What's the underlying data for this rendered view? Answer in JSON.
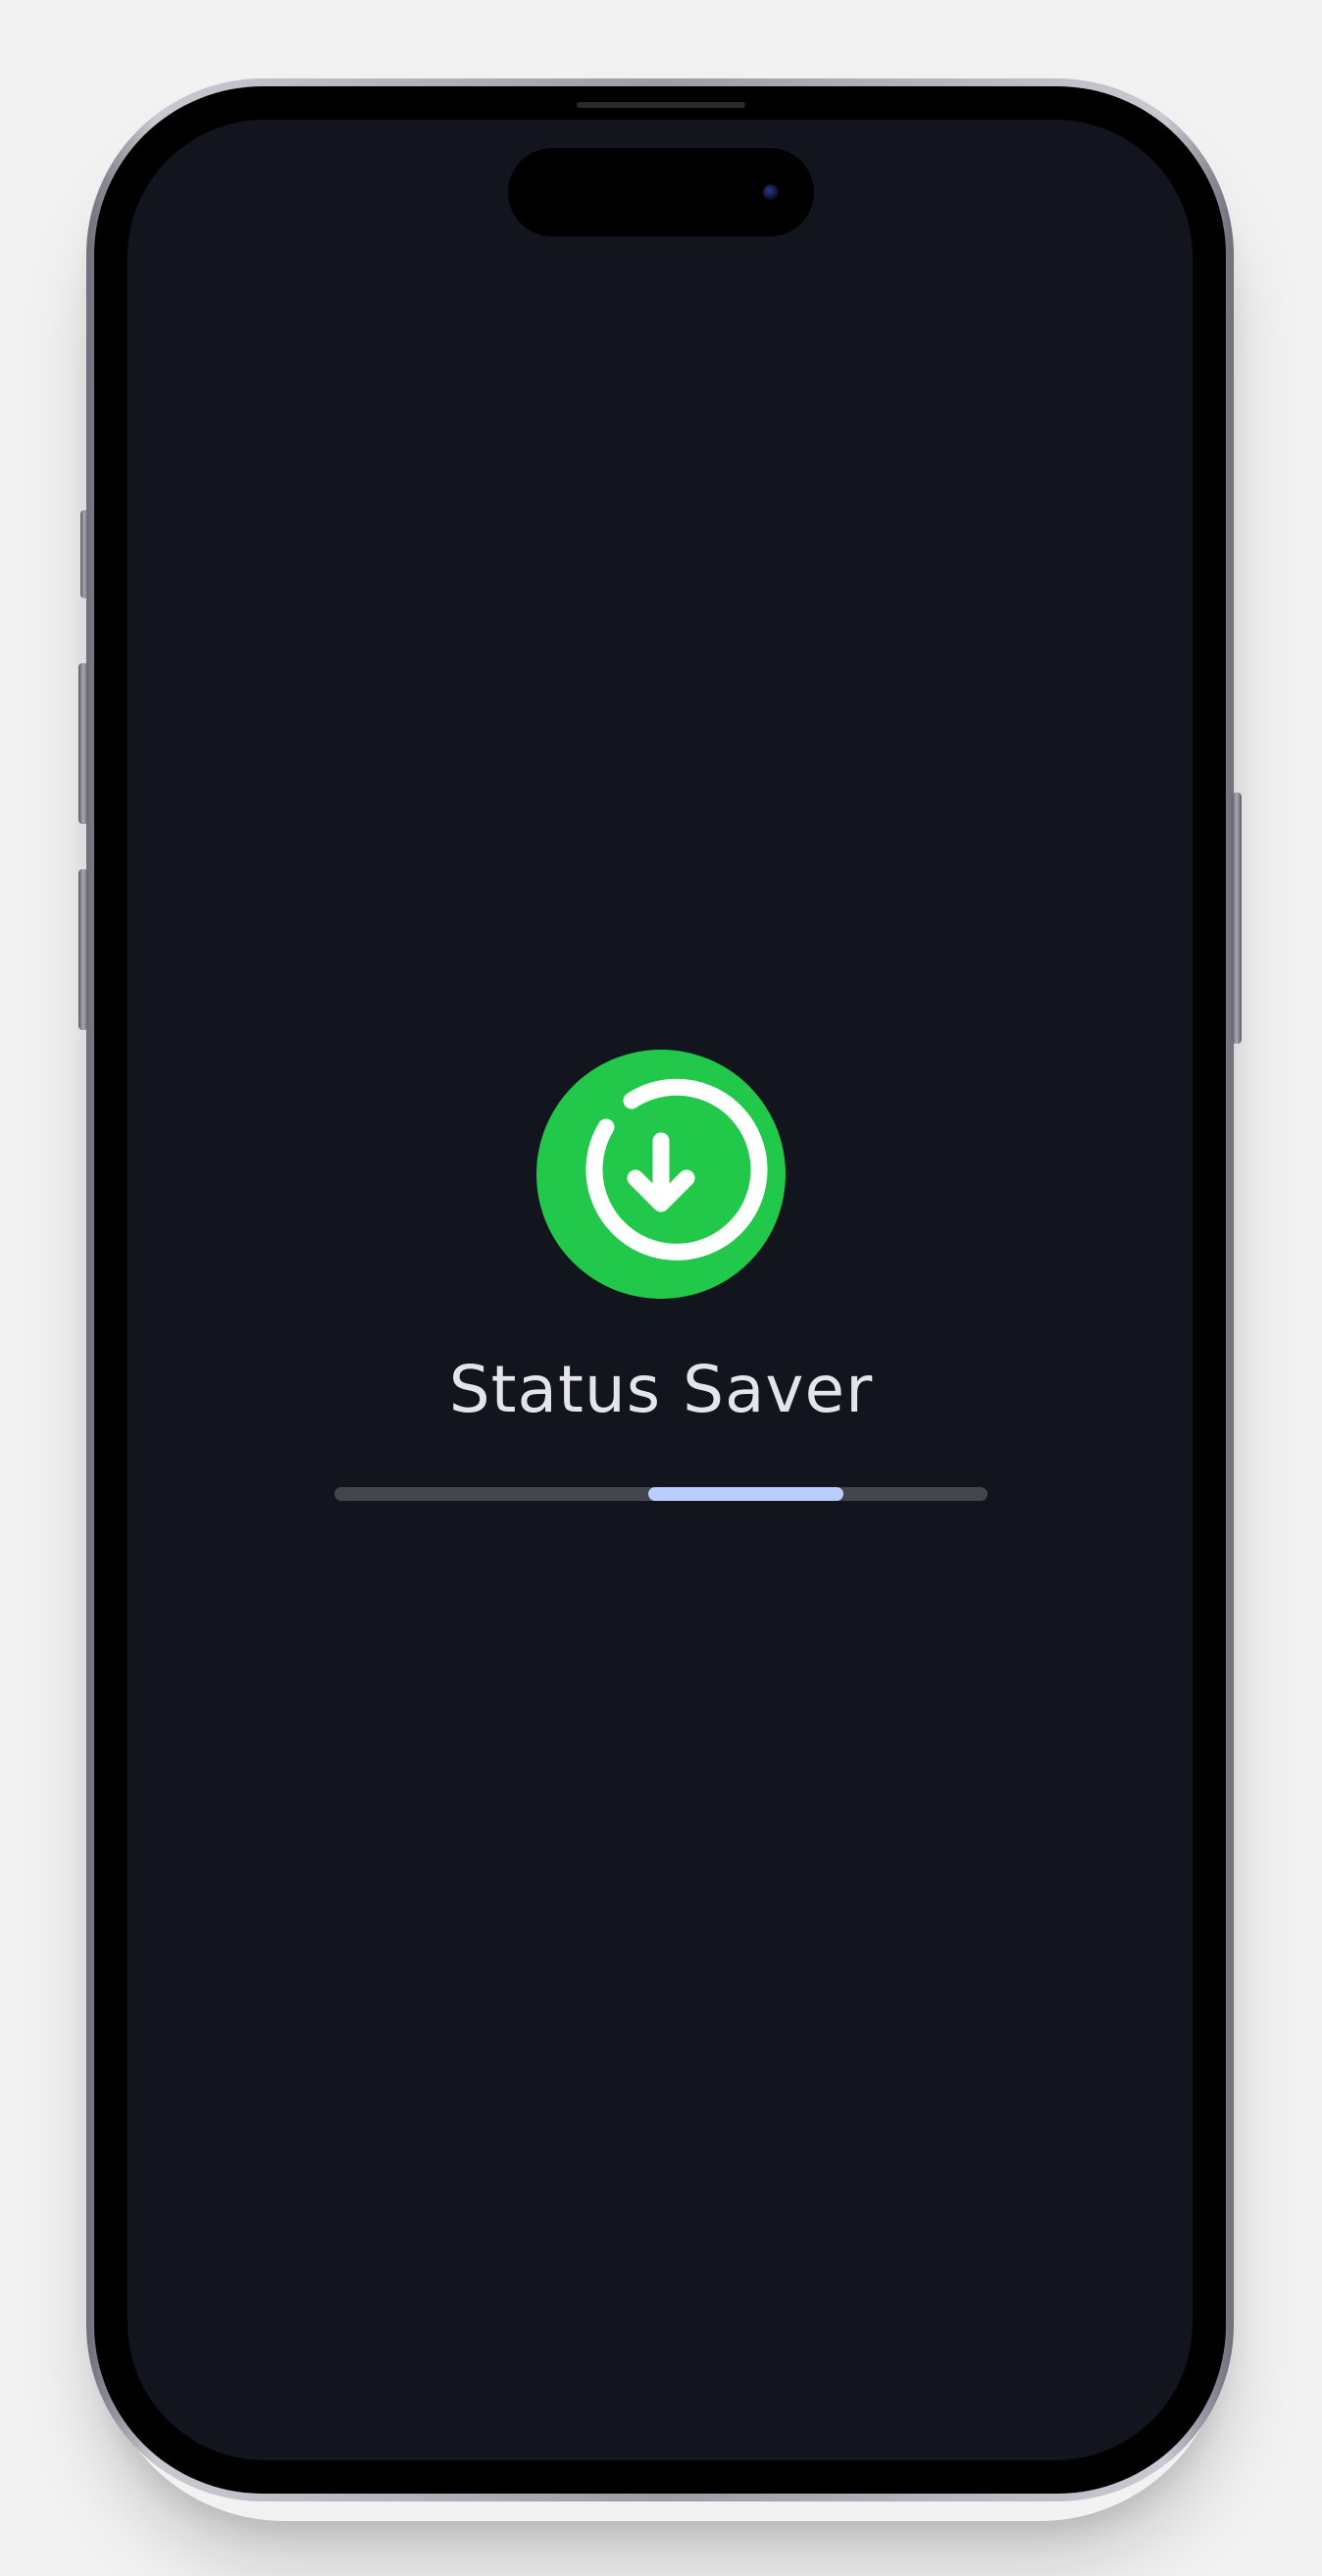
{
  "app": {
    "title": "Status Saver",
    "logo_icon": "download-arrow-circle-icon",
    "logo_color": "#22c84a",
    "background_color": "#12151d"
  },
  "loading": {
    "indeterminate": true,
    "highlight_start_fraction": 0.48,
    "highlight_end_fraction": 0.78,
    "track_color": "#44464e",
    "indicator_color": "#b9cdff"
  }
}
